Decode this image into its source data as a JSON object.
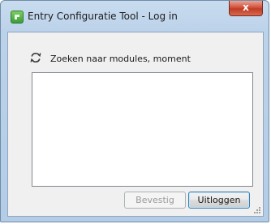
{
  "window": {
    "title": "Entry Configuratie Tool - Log in",
    "close_glyph": "x"
  },
  "status": {
    "icon": "refresh-icon",
    "text": "Zoeken naar modules, moment"
  },
  "module_list": {
    "items": []
  },
  "buttons": {
    "confirm_label": "Bevestig",
    "confirm_enabled": false,
    "logout_label": "Uitloggen"
  },
  "colors": {
    "titlebar": "#bcd2ea",
    "client": "#f0f0f0",
    "close_button": "#c03c25",
    "default_button_border": "#3c7fb1"
  }
}
